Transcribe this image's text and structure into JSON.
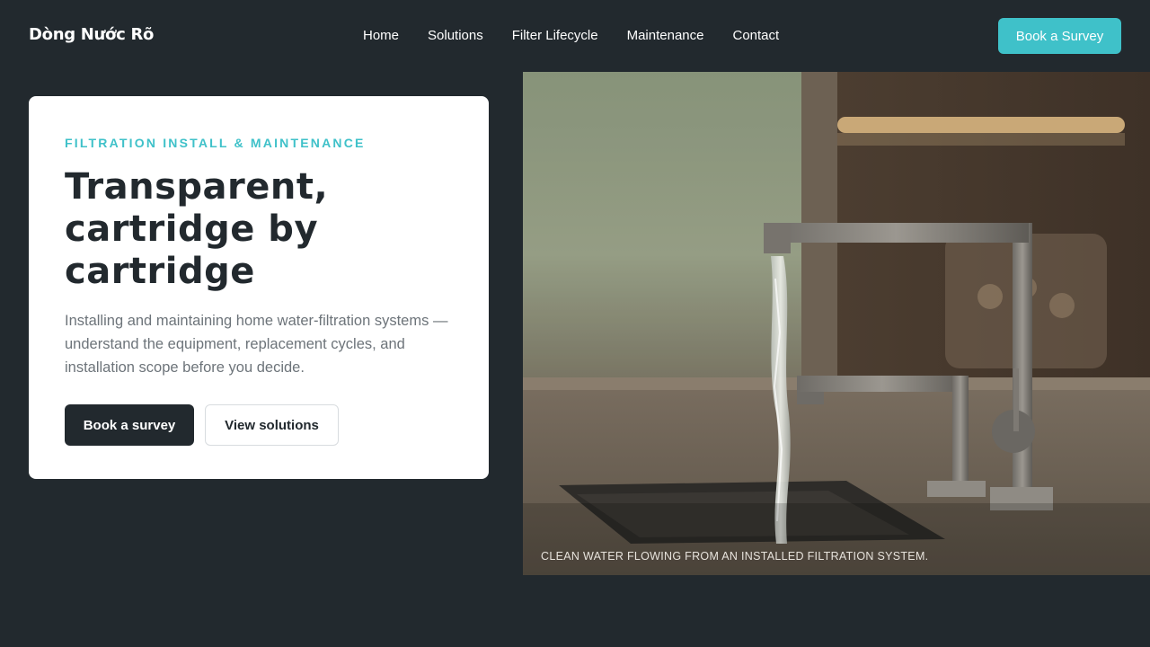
{
  "header": {
    "logo": "Dòng Nước Rõ",
    "nav": [
      "Home",
      "Solutions",
      "Filter Lifecycle",
      "Maintenance",
      "Contact"
    ],
    "cta": "Book a Survey"
  },
  "hero_card": {
    "eyebrow": "FILTRATION INSTALL & MAINTENANCE",
    "headline": "Transparent, cartridge by cartridge",
    "description": "Installing and maintaining home water-filtration systems — understand the equipment, replacement cycles, and installation scope before you decide.",
    "primary_button": "Book a survey",
    "secondary_button": "View solutions"
  },
  "hero_image": {
    "caption": "CLEAN WATER FLOWING FROM AN INSTALLED FILTRATION SYSTEM."
  },
  "colors": {
    "background": "#22292e",
    "accent": "#3fc1c9",
    "card": "#ffffff",
    "text_dark": "#22292e",
    "text_muted": "#6d747a"
  }
}
